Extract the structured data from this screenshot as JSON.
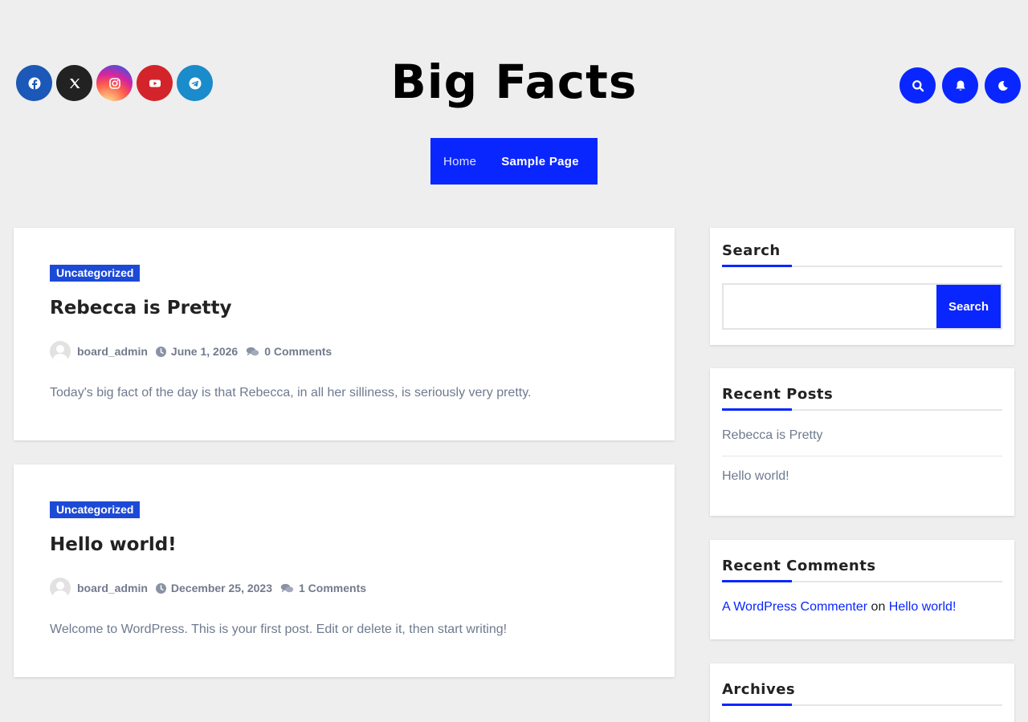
{
  "site": {
    "title": "Big Facts"
  },
  "social_icons": [
    "facebook-icon",
    "x-icon",
    "instagram-icon",
    "youtube-icon",
    "telegram-icon"
  ],
  "header_tools": [
    "search-icon",
    "bell-icon",
    "moon-icon"
  ],
  "nav": {
    "items": [
      {
        "label": "Home"
      },
      {
        "label": "Sample Page"
      }
    ]
  },
  "posts": [
    {
      "category": "Uncategorized",
      "title": "Rebecca is Pretty",
      "author": "board_admin",
      "date": "June 1, 2026",
      "comments": "0 Comments",
      "excerpt": "Today's big fact of the day is that Rebecca, in all her silliness, is seriously very pretty."
    },
    {
      "category": "Uncategorized",
      "title": "Hello world!",
      "author": "board_admin",
      "date": "December 25, 2023",
      "comments": "1 Comments",
      "excerpt": "Welcome to WordPress. This is your first post. Edit or delete it, then start writing!"
    }
  ],
  "sidebar": {
    "search": {
      "title": "Search",
      "value": "",
      "button": "Search"
    },
    "recent_posts": {
      "title": "Recent Posts",
      "items": [
        {
          "label": "Rebecca is Pretty"
        },
        {
          "label": "Hello world!"
        }
      ]
    },
    "recent_comments": {
      "title": "Recent Comments",
      "author": "A WordPress Commenter",
      "on": "on",
      "post": "Hello world!"
    },
    "archives": {
      "title": "Archives"
    }
  },
  "colors": {
    "accent": "#0a26ff",
    "badge": "#1c4ad7",
    "background": "#eeeeee"
  }
}
